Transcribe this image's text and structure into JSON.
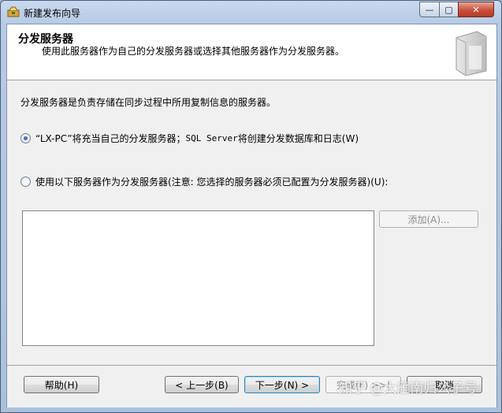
{
  "window": {
    "title": "新建发布向导",
    "controls": {
      "minimize": "—",
      "maximize": "▢",
      "close": "✕"
    }
  },
  "header": {
    "title": "分发服务器",
    "subtitle": "使用此服务器作为自己的分发服务器或选择其他服务器作为分发服务器。"
  },
  "body": {
    "description": "分发服务器是负责存储在同步过程中所用复制信息的服务器。",
    "option_self": {
      "selected": true,
      "label_part1": "“LX-PC”将充当自己的分发服务器；",
      "label_part2": "SQL Server",
      "label_part3": " 将创建分发数据库和日志(W)"
    },
    "option_other": {
      "selected": false,
      "label": "使用以下服务器作为分发服务器(注意: 您选择的服务器必须已配置为分发服务器)(U):"
    },
    "server_list_items": [],
    "add_button": "添加(A)..."
  },
  "footer": {
    "help": "帮助(H)",
    "back": "< 上一步(B)",
    "next": "下一步(N) >",
    "finish": "完成(F) >>|",
    "cancel": "取消"
  },
  "watermark": "知乎 @大雁南归公子号"
}
